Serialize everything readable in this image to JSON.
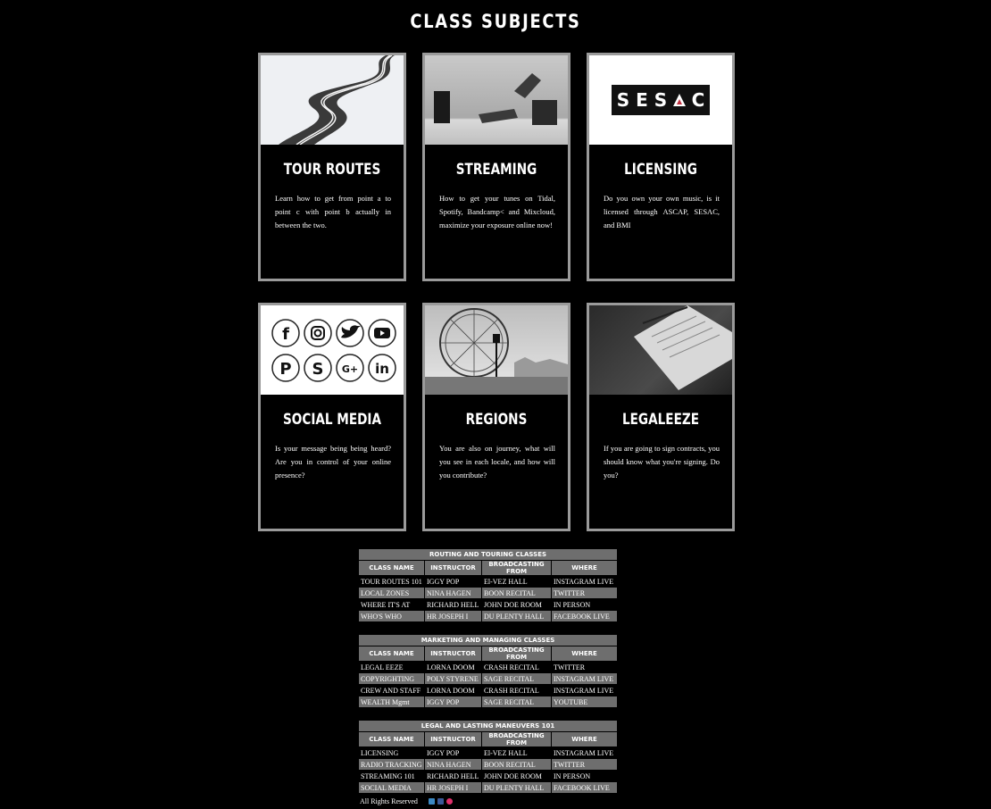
{
  "page": {
    "title": "CLASS SUBJECTS"
  },
  "cards": [
    {
      "title": "TOUR ROUTES",
      "desc": "Learn how to get from point a to point c with point b actually in between the two."
    },
    {
      "title": "STREAMING",
      "desc": "How to get your tunes on Tidal, Spotify, Bandcamp< and Mixcloud, maximize your exposure online now!"
    },
    {
      "title": "LICENSING",
      "desc": "Do you own your own music, is it licensed through ASCAP, SESAC, and BMI",
      "logo": "SESAC"
    },
    {
      "title": "SOCIAL MEDIA",
      "desc": "Is your message being being heard? Are you in control of your online presence?"
    },
    {
      "title": "REGIONS",
      "desc": "You are also on journey, what will you see in each locale, and how will you contribute?"
    },
    {
      "title": "LEGALEEZE",
      "desc": "If you are going to sign contracts, you should know what you're signing. Do you?"
    }
  ],
  "social_icons": [
    "facebook-icon",
    "instagram-icon",
    "twitter-icon",
    "youtube-icon",
    "pinterest-icon",
    "skype-icon",
    "google-plus-icon",
    "linkedin-icon"
  ],
  "tables": [
    {
      "caption": "ROUTING AND TOURING CLASSES",
      "headers": [
        "CLASS NAME",
        "INSTRUCTOR",
        "BROADCASTING FROM",
        "WHERE"
      ],
      "rows": [
        [
          "TOUR ROUTES 101",
          "IGGY POP",
          "El-VEZ HALL",
          "INSTAGRAM LIVE"
        ],
        [
          "LOCAL ZONES",
          "NINA HAGEN",
          "BOON RECITAL",
          "TWITTER"
        ],
        [
          "WHERE IT'S AT",
          "RICHARD HELL",
          "JOHN DOE ROOM",
          "IN PERSON"
        ],
        [
          "WHO'S WHO",
          "HR JOSEPH I",
          "DU PLENTY HALL",
          "FACEBOOK LIVE"
        ]
      ]
    },
    {
      "caption": "MARKETING AND MANAGING CLASSES",
      "headers": [
        "CLASS NAME",
        "INSTRUCTOR",
        "BROADCASTING FROM",
        "WHERE"
      ],
      "rows": [
        [
          "LEGAL EEZE",
          "LORNA DOOM",
          "CRASH RECITAL",
          "TWITTER"
        ],
        [
          "COPYRIGHTING",
          "POLY STYRENE",
          "SAGE RECITAL",
          "INSTAGRAM LIVE"
        ],
        [
          "CREW AND STAFF",
          "LORNA DOOM",
          "CRASH RECITAL",
          "INSTAGRAM LIVE"
        ],
        [
          "WEALTH Mgmt",
          "IGGY POP",
          "SAGE RECITAL",
          "YOUTUBE"
        ]
      ]
    },
    {
      "caption": "LEGAL AND LASTING MANEUVERS 101",
      "headers": [
        "CLASS NAME",
        "INSTRUCTOR",
        "BROADCASTING FROM",
        "WHERE"
      ],
      "rows": [
        [
          "LICENSING",
          "IGGY POP",
          "El-VEZ HALL",
          "INSTAGRAM LIVE"
        ],
        [
          "RADIO TRACKING",
          "NINA HAGEN",
          "BOON RECITAL",
          "TWITTER"
        ],
        [
          "STREAMING 101",
          "RICHARD HELL",
          "JOHN DOE ROOM",
          "IN PERSON"
        ],
        [
          "SOCIAL MEDIA",
          "HR JOSEPH I",
          "DU PLENTY HALL",
          "FACEBOOK LIVE"
        ]
      ]
    }
  ],
  "footer": {
    "text": "All Rights Reserved",
    "icons": [
      "twitter-icon",
      "facebook-icon",
      "instagram-icon"
    ]
  }
}
